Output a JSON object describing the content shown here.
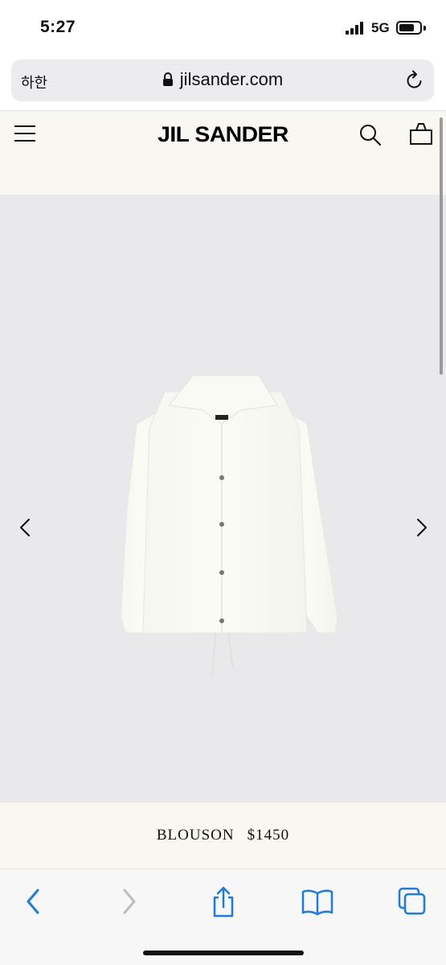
{
  "status_bar": {
    "time": "5:27",
    "network": "5G",
    "battery_level": 0.75
  },
  "browser": {
    "translate_label": "하한",
    "url": "jilsander.com",
    "icons": {
      "lock": "lock-icon",
      "reload": "reload-icon"
    }
  },
  "site": {
    "logo": "JIL SANDER",
    "icons": [
      "menu-icon",
      "search-icon",
      "bag-icon"
    ]
  },
  "product": {
    "name": "BLOUSON",
    "price": "$1450",
    "carousel_icons": [
      "chevron-left-icon",
      "chevron-right-icon"
    ]
  },
  "toolbar": {
    "icons": [
      "back-icon",
      "forward-icon",
      "share-icon",
      "bookmarks-icon",
      "tabs-icon"
    ]
  },
  "colors": {
    "header_bg": "#f8f7f2",
    "image_bg": "#e9e9eb",
    "accent": "#1a7ae8",
    "disabled": "#b9bcc2"
  }
}
